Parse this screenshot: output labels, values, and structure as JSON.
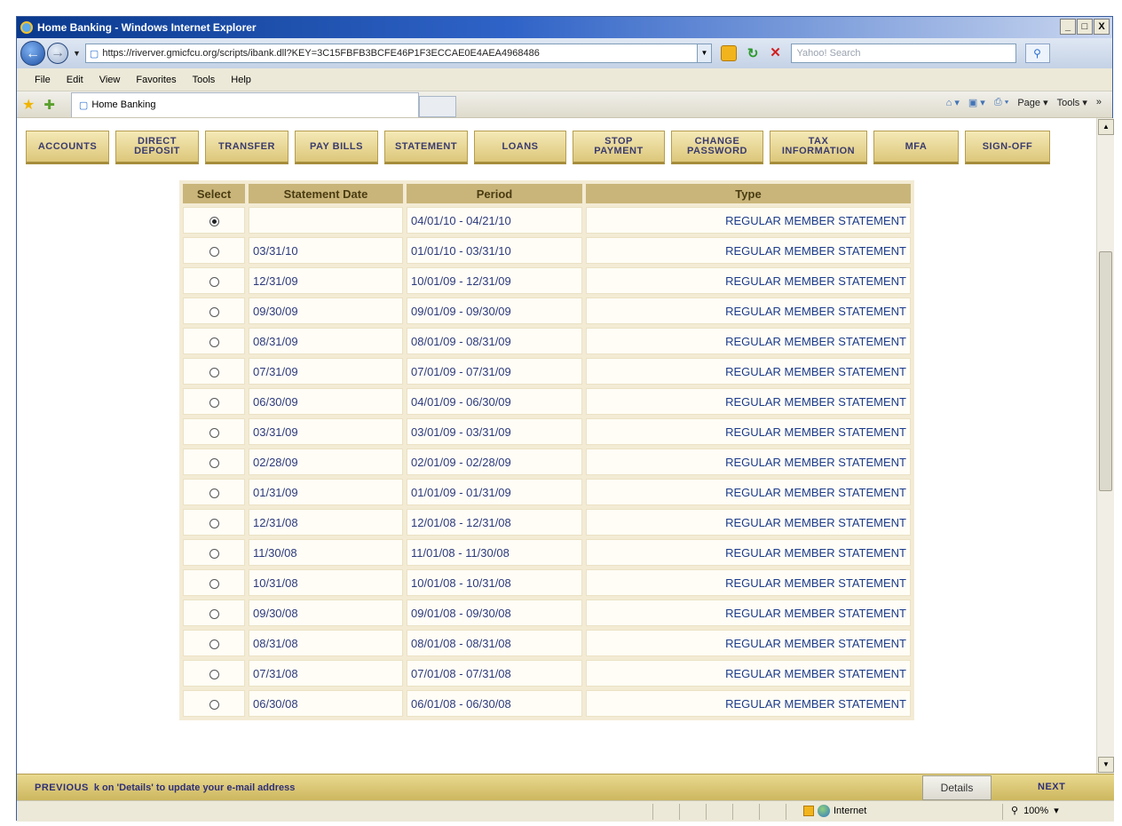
{
  "window": {
    "title": "Home Banking - Windows Internet Explorer",
    "controls": [
      "_",
      "□",
      "X"
    ]
  },
  "address_bar": {
    "url": "https://riverver.gmicfcu.org/scripts/ibank.dll?KEY=3C15FBFB3BCFE46P1F3ECCAE0E4AEA4968486",
    "search_placeholder": "Yahoo! Search"
  },
  "menu": [
    "File",
    "Edit",
    "View",
    "Favorites",
    "Tools",
    "Help"
  ],
  "tab": {
    "title": "Home Banking"
  },
  "command_bar": {
    "page_label": "Page",
    "tools_label": "Tools",
    "more": "»"
  },
  "nav": [
    {
      "label": "ACCOUNTS"
    },
    {
      "label": "DIRECT\nDEPOSIT"
    },
    {
      "label": "TRANSFER"
    },
    {
      "label": "PAY BILLS"
    },
    {
      "label": "STATEMENT"
    },
    {
      "label": "LOANS"
    },
    {
      "label": "STOP\nPAYMENT"
    },
    {
      "label": "CHANGE\nPASSWORD"
    },
    {
      "label": "TAX\nINFORMATION"
    },
    {
      "label": "MFA"
    },
    {
      "label": "SIGN-OFF"
    }
  ],
  "table": {
    "headers": [
      "Select",
      "Statement Date",
      "Period",
      "Type"
    ],
    "rows": [
      {
        "selected": true,
        "date": "",
        "period": "04/01/10 - 04/21/10",
        "type": "REGULAR MEMBER STATEMENT"
      },
      {
        "selected": false,
        "date": "03/31/10",
        "period": "01/01/10 - 03/31/10",
        "type": "REGULAR MEMBER STATEMENT"
      },
      {
        "selected": false,
        "date": "12/31/09",
        "period": "10/01/09 - 12/31/09",
        "type": "REGULAR MEMBER STATEMENT"
      },
      {
        "selected": false,
        "date": "09/30/09",
        "period": "09/01/09 - 09/30/09",
        "type": "REGULAR MEMBER STATEMENT"
      },
      {
        "selected": false,
        "date": "08/31/09",
        "period": "08/01/09 - 08/31/09",
        "type": "REGULAR MEMBER STATEMENT"
      },
      {
        "selected": false,
        "date": "07/31/09",
        "period": "07/01/09 - 07/31/09",
        "type": "REGULAR MEMBER STATEMENT"
      },
      {
        "selected": false,
        "date": "06/30/09",
        "period": "04/01/09 - 06/30/09",
        "type": "REGULAR MEMBER STATEMENT"
      },
      {
        "selected": false,
        "date": "03/31/09",
        "period": "03/01/09 - 03/31/09",
        "type": "REGULAR MEMBER STATEMENT"
      },
      {
        "selected": false,
        "date": "02/28/09",
        "period": "02/01/09 - 02/28/09",
        "type": "REGULAR MEMBER STATEMENT"
      },
      {
        "selected": false,
        "date": "01/31/09",
        "period": "01/01/09 - 01/31/09",
        "type": "REGULAR MEMBER STATEMENT"
      },
      {
        "selected": false,
        "date": "12/31/08",
        "period": "12/01/08 - 12/31/08",
        "type": "REGULAR MEMBER STATEMENT"
      },
      {
        "selected": false,
        "date": "11/30/08",
        "period": "11/01/08 - 11/30/08",
        "type": "REGULAR MEMBER STATEMENT"
      },
      {
        "selected": false,
        "date": "10/31/08",
        "period": "10/01/08 - 10/31/08",
        "type": "REGULAR MEMBER STATEMENT"
      },
      {
        "selected": false,
        "date": "09/30/08",
        "period": "09/01/08 - 09/30/08",
        "type": "REGULAR MEMBER STATEMENT"
      },
      {
        "selected": false,
        "date": "08/31/08",
        "period": "08/01/08 - 08/31/08",
        "type": "REGULAR MEMBER STATEMENT"
      },
      {
        "selected": false,
        "date": "07/31/08",
        "period": "07/01/08 - 07/31/08",
        "type": "REGULAR MEMBER STATEMENT"
      },
      {
        "selected": false,
        "date": "06/30/08",
        "period": "06/01/08 - 06/30/08",
        "type": "REGULAR MEMBER STATEMENT"
      }
    ]
  },
  "bottom_bar": {
    "previous": "PREVIOUS",
    "info": "k on 'Details' to update your e-mail address",
    "details": "Details",
    "next": "NEXT"
  },
  "status_bar": {
    "zone": "Internet",
    "zoom": "100%"
  },
  "colors": {
    "accent_gold": "#c9b57a",
    "button_text": "#3a3b6e",
    "link_blue": "#2c3a7c"
  }
}
